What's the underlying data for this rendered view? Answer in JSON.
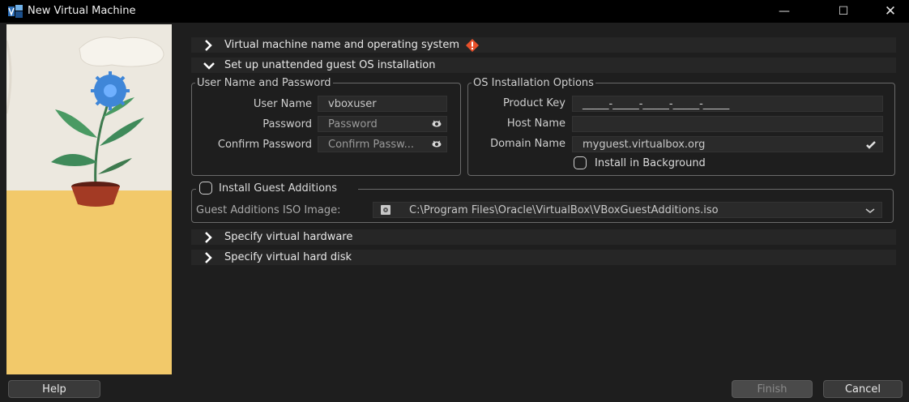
{
  "window": {
    "title": "New Virtual Machine",
    "minimize_glyph": "—",
    "maximize_glyph": "☐",
    "close_glyph": "✕"
  },
  "sections": {
    "name_os": {
      "label": "Virtual machine name and operating system",
      "expanded": false,
      "has_warning": true
    },
    "unattended": {
      "label": "Set up unattended guest OS installation",
      "expanded": true
    },
    "hardware": {
      "label": "Specify virtual hardware",
      "expanded": false
    },
    "hard_disk": {
      "label": "Specify virtual hard disk",
      "expanded": false
    }
  },
  "user_group": {
    "title": "User Name and Password",
    "username_label": "User Name",
    "username_value": "vboxuser",
    "password_label": "Password",
    "password_placeholder": "Password",
    "confirm_label": "Confirm Password",
    "confirm_placeholder": "Confirm Passw..."
  },
  "os_group": {
    "title": "OS Installation Options",
    "product_key_label": "Product Key",
    "product_key_mask": "_____-_____-_____-_____-_____",
    "host_name_label": "Host Name",
    "host_name_value": "",
    "domain_name_label": "Domain Name",
    "domain_name_value": "myguest.virtualbox.org",
    "install_bg_label": "Install in Background",
    "install_bg_checked": false
  },
  "guest_additions": {
    "title": "Install Guest Additions",
    "checked": false,
    "iso_label": "Guest Additions ISO Image:",
    "iso_path": "C:\\Program Files\\Oracle\\VirtualBox\\VBoxGuestAdditions.iso"
  },
  "buttons": {
    "help": "Help",
    "finish": "Finish",
    "cancel": "Cancel"
  },
  "colors": {
    "background": "#1e1e1e",
    "titlebar": "#000000",
    "warning": "#e8502a",
    "illustration_sky": "#ece8df",
    "illustration_ground": "#f2c96a"
  }
}
